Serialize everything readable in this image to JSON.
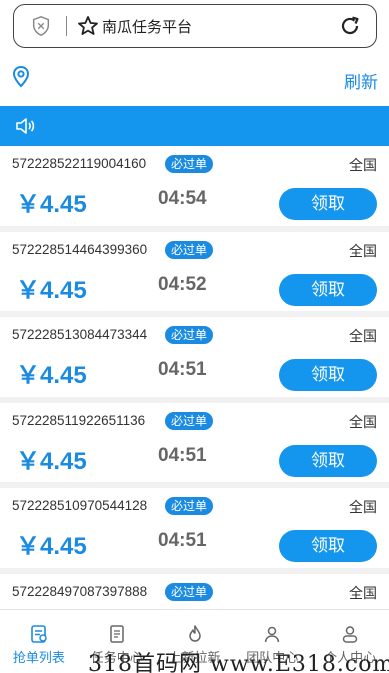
{
  "browser": {
    "url_text": "南瓜任务平台"
  },
  "header": {
    "refresh_label": "刷新"
  },
  "orders": [
    {
      "id": "572228522119004160",
      "badge": "必过单",
      "region": "全国",
      "price": "￥4.45",
      "timer": "04:54",
      "action": "领取"
    },
    {
      "id": "572228514464399360",
      "badge": "必过单",
      "region": "全国",
      "price": "￥4.45",
      "timer": "04:52",
      "action": "领取"
    },
    {
      "id": "572228513084473344",
      "badge": "必过单",
      "region": "全国",
      "price": "￥4.45",
      "timer": "04:51",
      "action": "领取"
    },
    {
      "id": "572228511922651136",
      "badge": "必过单",
      "region": "全国",
      "price": "￥4.45",
      "timer": "04:51",
      "action": "领取"
    },
    {
      "id": "572228510970544128",
      "badge": "必过单",
      "region": "全国",
      "price": "￥4.45",
      "timer": "04:51",
      "action": "领取"
    },
    {
      "id": "572228497087397888",
      "badge": "必过单",
      "region": "全国",
      "price": "",
      "timer": "",
      "action": ""
    }
  ],
  "bottom_nav": [
    {
      "label": "抢单列表",
      "icon": "order-list-icon",
      "active": true
    },
    {
      "label": "任务中心",
      "icon": "task-doc-icon",
      "active": false
    },
    {
      "label": "上新拉新",
      "icon": "flame-icon",
      "active": false
    },
    {
      "label": "团队中心",
      "icon": "team-icon",
      "active": false
    },
    {
      "label": "个人中心",
      "icon": "user-icon",
      "active": false
    }
  ],
  "watermark": "318首码网 www.E318.com",
  "colors": {
    "accent": "#1496ee",
    "text_blue": "#1a8be0",
    "background": "#f1f1f1"
  }
}
